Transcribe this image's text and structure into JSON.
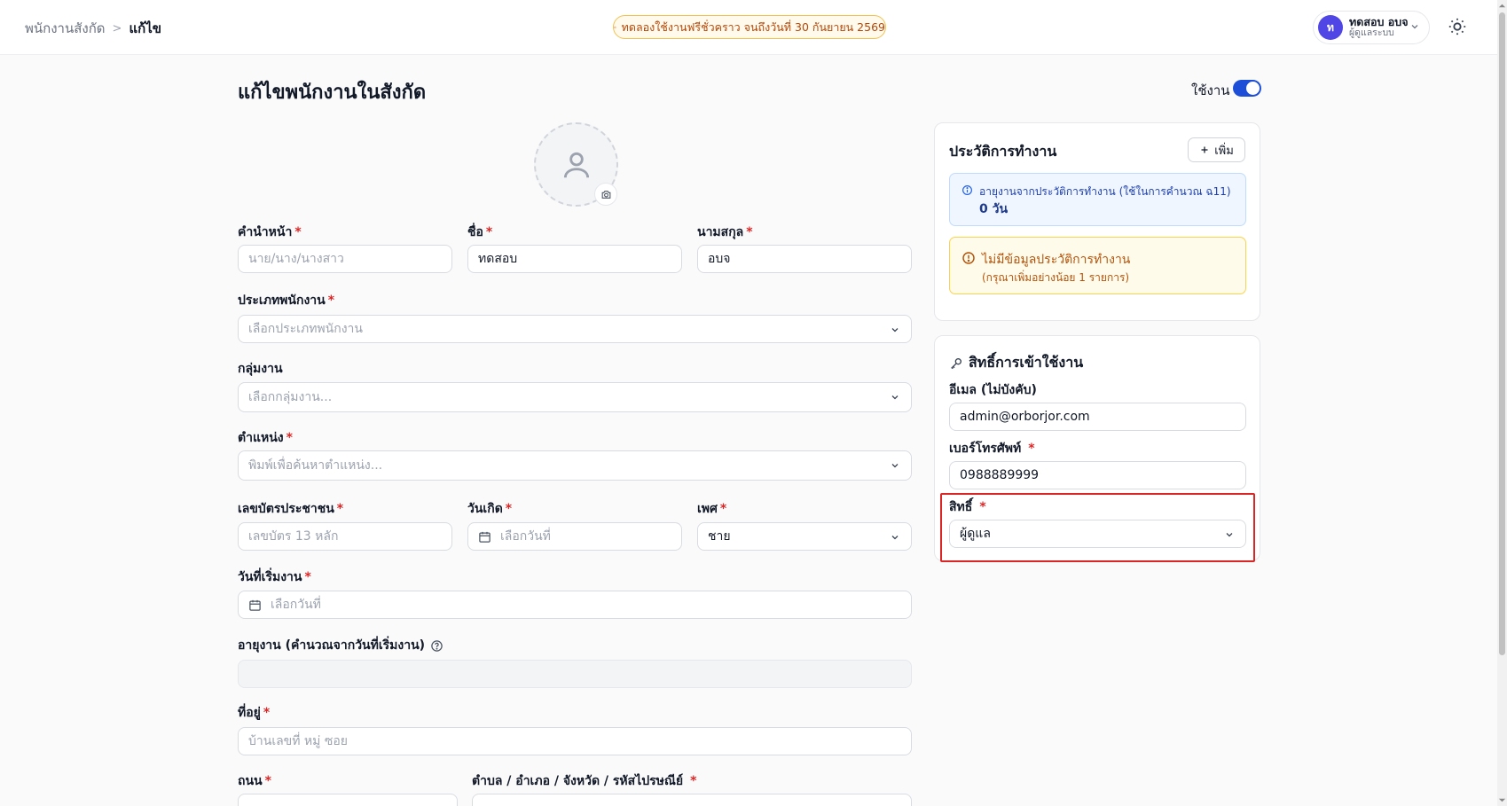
{
  "breadcrumb": {
    "parent": "พนักงานสังกัด",
    "separator": ">",
    "current": "แก้ไข"
  },
  "trial_banner": "ทดลองใช้งานฟรีชั่วคราว จนถึงวันที่ 30 กันยายน 2569",
  "user": {
    "initial": "ท",
    "name": "ทดสอบ อบจ",
    "role": "ผู้ดูแลระบบ"
  },
  "page": {
    "title": "แก้ไขพนักงานในสังกัด",
    "active_label": "ใช้งาน",
    "active_on": true
  },
  "form": {
    "required_mark": "*",
    "prefix": {
      "label": "คำนำหน้า",
      "placeholder": "นาย/นาง/นางสาว"
    },
    "first_name": {
      "label": "ชื่อ",
      "value": "ทดสอบ"
    },
    "last_name": {
      "label": "นามสกุล",
      "value": "อบจ"
    },
    "employee_type": {
      "label": "ประเภทพนักงาน",
      "placeholder": "เลือกประเภทพนักงาน"
    },
    "work_group": {
      "label": "กลุ่มงาน",
      "placeholder": "เลือกกลุ่มงาน..."
    },
    "position": {
      "label": "ตำแหน่ง",
      "placeholder": "พิมพ์เพื่อค้นหาตำแหน่ง..."
    },
    "national_id": {
      "label": "เลขบัตรประชาชน",
      "placeholder": "เลขบัตร 13 หลัก"
    },
    "birth_date": {
      "label": "วันเกิด",
      "placeholder": "เลือกวันที่"
    },
    "gender": {
      "label": "เพศ",
      "value": "ชาย"
    },
    "start_date": {
      "label": "วันที่เริ่มงาน",
      "placeholder": "เลือกวันที่"
    },
    "service_age": {
      "label": "อายุงาน (คำนวณจากวันที่เริ่มงาน)"
    },
    "address": {
      "label": "ที่อยู่",
      "placeholder": "บ้านเลขที่ หมู่ ซอย"
    },
    "road": {
      "label": "ถนน"
    },
    "subdistrict": {
      "label": "ตำบล / อำเภอ / จังหวัด / รหัสไปรษณีย์"
    }
  },
  "work_history": {
    "title": "ประวัติการทำงาน",
    "add_label": "เพิ่ม",
    "info_text": "อายุงานจากประวัติการทำงาน (ใช้ในการคำนวณ ฉ11)",
    "info_value": "0 วัน",
    "warn_title": "ไม่มีข้อมูลประวัติการทำงาน",
    "warn_sub": "(กรุณาเพิ่มอย่างน้อย 1 รายการ)"
  },
  "access": {
    "title": "สิทธิ์การเข้าใช้งาน",
    "email_label": "อีเมล (ไม่บังคับ)",
    "email_value": "admin@orborjor.com",
    "phone_label": "เบอร์โทรศัพท์",
    "phone_value": "0988889999",
    "role_label": "สิทธิ์",
    "role_value": "ผู้ดูแล"
  },
  "colors": {
    "primary": "#1d4ed8",
    "required": "#dc2626",
    "warning": "#b45309",
    "info": "#1e40af"
  }
}
